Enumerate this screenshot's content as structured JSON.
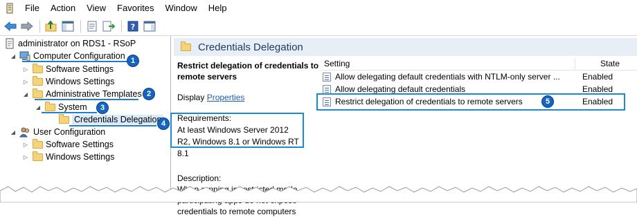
{
  "menu": {
    "items": [
      "File",
      "Action",
      "View",
      "Favorites",
      "Window",
      "Help"
    ]
  },
  "toolbar": {
    "icons": [
      "back-arrow-icon",
      "forward-arrow-icon",
      "up-folder-icon",
      "show-hide-tree-icon",
      "properties-icon",
      "export-list-icon",
      "help-icon",
      "action-pane-icon"
    ]
  },
  "tree": {
    "root": "administrator on RDS1 - RSoP",
    "computer_configuration": "Computer Configuration",
    "software_settings_1": "Software Settings",
    "windows_settings_1": "Windows Settings",
    "administrative_templates": "Administrative Templates",
    "system": "System",
    "credentials_delegation": "Credentials Delegation",
    "user_configuration": "User Configuration",
    "software_settings_2": "Software Settings",
    "windows_settings_2": "Windows Settings"
  },
  "badges": [
    "1",
    "2",
    "3",
    "4",
    "5"
  ],
  "header": {
    "title": "Credentials Delegation"
  },
  "description": {
    "policy_title": "Restrict delegation of credentials to remote servers",
    "display_label": "Display",
    "properties_link": "Properties",
    "requirements_label": "Requirements:",
    "requirements_text": "At least Windows Server 2012 R2, Windows 8.1 or Windows RT 8.1",
    "description_label": "Description:",
    "description_text": "When running in restricted mode, participating apps do not expose credentials to remote computers"
  },
  "list": {
    "col_setting": "Setting",
    "col_state": "State",
    "rows": [
      {
        "setting": "Allow delegating default credentials with NTLM-only server ...",
        "state": "Enabled"
      },
      {
        "setting": "Allow delegating default credentials",
        "state": "Enabled"
      },
      {
        "setting": "Restrict delegation of credentials to remote servers",
        "state": "Enabled"
      }
    ]
  },
  "colors": {
    "highlight_box": "#1a8ad4",
    "badge": "#1565c0",
    "header_band": "#e8eef6"
  }
}
